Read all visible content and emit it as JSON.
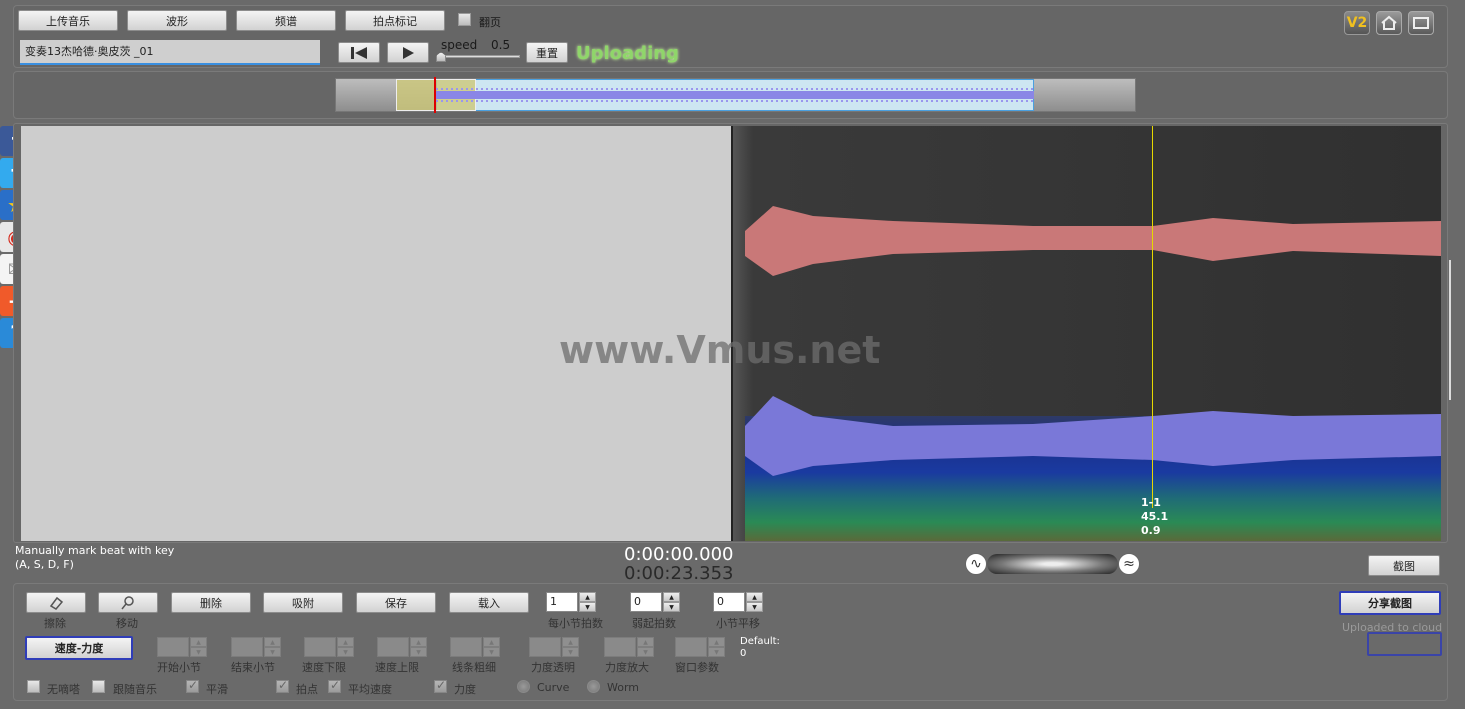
{
  "toolbar": {
    "upload_music": "上传音乐",
    "waveform": "波形",
    "spectrum": "频谱",
    "beat_marks": "拍点标记",
    "page_flip_label": "翻页",
    "v2_badge": "V2"
  },
  "file": {
    "name": "变奏13杰哈德·奥皮茨 _01"
  },
  "playback": {
    "speed_label": "speed",
    "speed_value": "0.5",
    "reset_label": "重置",
    "status": "Uploading"
  },
  "watermark": "www.Vmus.net",
  "marker": {
    "beat": "1-1",
    "tempo": "45.1",
    "value": "0.9"
  },
  "hint": {
    "line1": "Manually mark beat with key",
    "line2": "(A, S, D, F)"
  },
  "time": {
    "current": "0:00:00.000",
    "total": "0:00:23.353"
  },
  "screenshot_label": "截图",
  "tools": {
    "erase_label": "擦除",
    "move_label": "移动",
    "delete": "删除",
    "snap": "吸附",
    "save": "保存",
    "load": "载入"
  },
  "params": {
    "beats_per_bar": {
      "value": "1",
      "label": "每小节拍数"
    },
    "upbeat": {
      "value": "0",
      "label": "弱起拍数"
    },
    "bar_offset": {
      "value": "0",
      "label": "小节平移"
    }
  },
  "mode_button": "速度-力度",
  "range": {
    "start_bar": "开始小节",
    "end_bar": "结束小节",
    "tempo_min": "速度下限",
    "tempo_max": "速度上限",
    "line_width": "线条粗细",
    "dyn_opacity": "力度透明",
    "dyn_zoom": "力度放大",
    "window_param": "窗口参数",
    "default_label": "Default:",
    "default_value": "0"
  },
  "share": {
    "button": "分享截图",
    "uploaded": "Uploaded to cloud"
  },
  "options": {
    "no_metronome": "无嘀嗒",
    "follow_music": "跟随音乐",
    "smooth": "平滑",
    "beats": "拍点",
    "avg_tempo": "平均速度",
    "dynamics": "力度",
    "curve": "Curve",
    "worm": "Worm"
  },
  "colors": {
    "status_green": "#8fd66a",
    "wave_top": "#c97878",
    "wave_bottom": "#7a78d8",
    "cursor": "#e6d800"
  }
}
